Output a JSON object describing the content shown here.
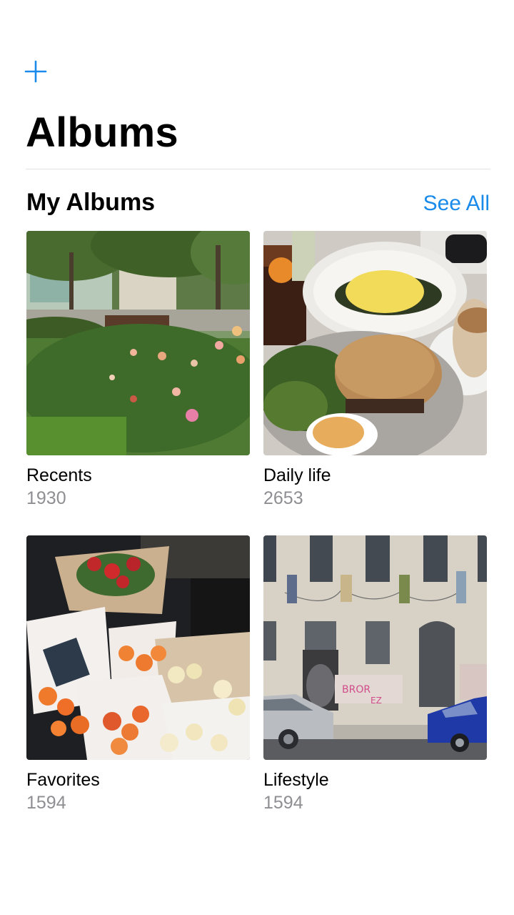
{
  "header": {
    "add_icon": "plus-icon",
    "title": "Albums"
  },
  "section": {
    "title": "My Albums",
    "see_all": "See All"
  },
  "accent_color": "#1a8bea",
  "albums": [
    {
      "name": "Recents",
      "count": "1930"
    },
    {
      "name": "Daily life",
      "count": "2653"
    },
    {
      "name": "Favorites",
      "count": "1594"
    },
    {
      "name": "Lifestyle",
      "count": "1594"
    }
  ]
}
